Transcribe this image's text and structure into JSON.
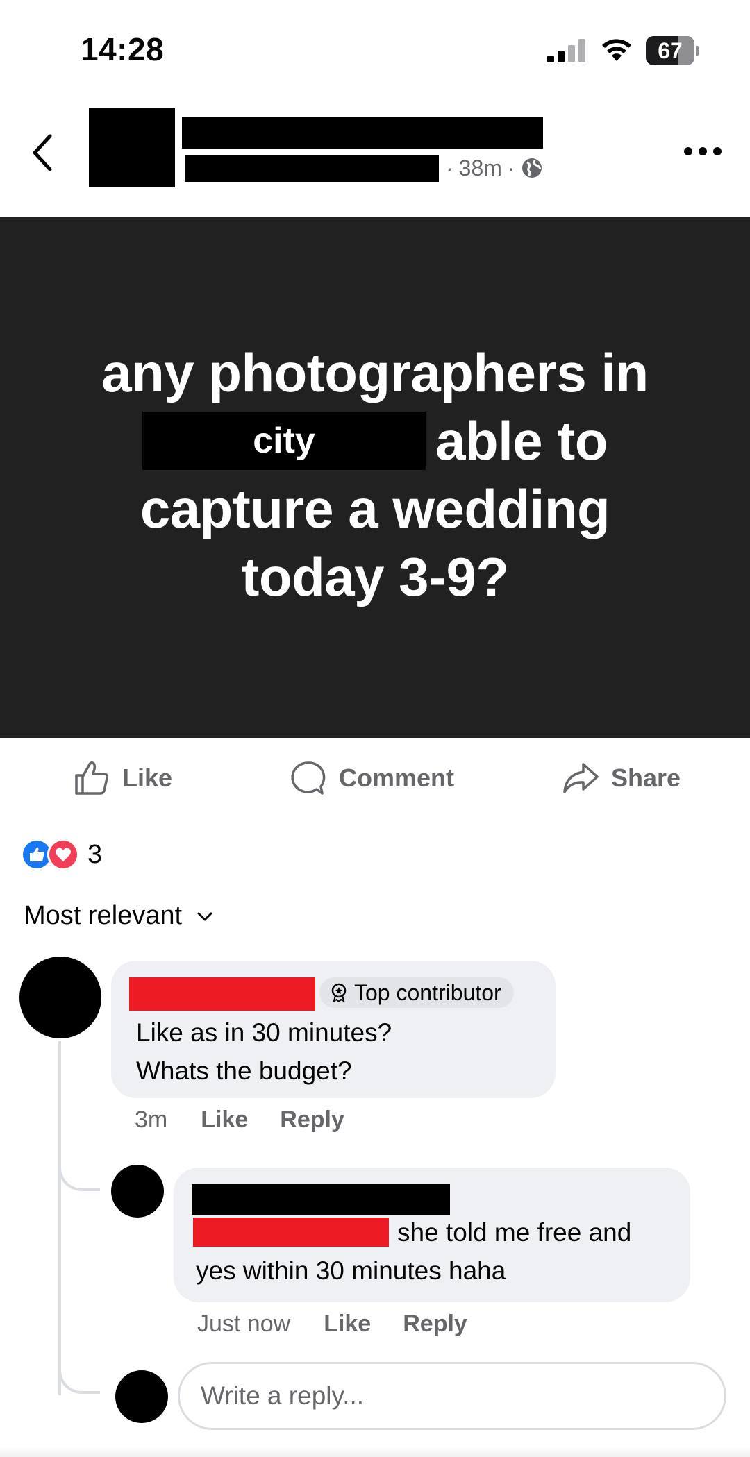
{
  "status_bar": {
    "time": "14:28",
    "battery": "67"
  },
  "post": {
    "time_ago": "38m",
    "image_text": {
      "line1": "any photographers in",
      "city_label": "city",
      "line2_rest": "able to",
      "line3": "capture a wedding",
      "line4": "today 3-9?"
    }
  },
  "actions": {
    "like": "Like",
    "comment": "Comment",
    "share": "Share"
  },
  "reactions": {
    "count": "3",
    "types": [
      "like",
      "love"
    ]
  },
  "sort": {
    "label": "Most relevant"
  },
  "comments": [
    {
      "badge": "Top contributor",
      "text": "Like as in 30 minutes?\nWhats the budget?",
      "time": "3m",
      "like": "Like",
      "reply": "Reply"
    },
    {
      "text_line1": "she told me free and",
      "text_line2": "yes within 30 minutes haha",
      "time": "Just now",
      "like": "Like",
      "reply": "Reply"
    }
  ],
  "reply_box": {
    "placeholder": "Write a reply..."
  },
  "colors": {
    "image_bg": "#212121",
    "redact_red": "#ed1c24",
    "bubble": "#eff0f3",
    "muted": "#65676b",
    "like_blue": "#1877f2",
    "love_red": "#f33e58"
  }
}
